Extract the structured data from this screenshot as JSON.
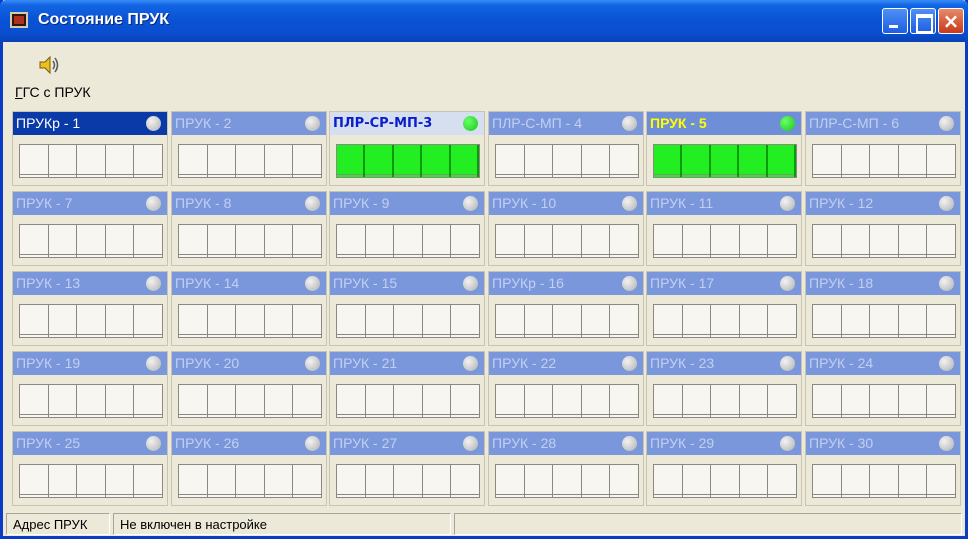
{
  "window": {
    "title": "Состояние ПРУК"
  },
  "toolbar": {
    "ggs_button": {
      "underlined": "Г",
      "rest": "ГС с ПРУК",
      "icon": "speaker-icon"
    }
  },
  "panels": [
    {
      "label": "ПРУКр - 1",
      "state": "selected",
      "indicator": "gray",
      "active": false
    },
    {
      "label": "ПРУК - 2",
      "state": "normal",
      "indicator": "gray",
      "active": false
    },
    {
      "label": "ПЛР-СР-МП-3",
      "state": "light",
      "indicator": "green",
      "active": true
    },
    {
      "label": "ПЛР-С-МП - 4",
      "state": "normal",
      "indicator": "gray",
      "active": false
    },
    {
      "label": "ПРУК - 5",
      "state": "yellow",
      "indicator": "green",
      "active": true
    },
    {
      "label": "ПЛР-С-МП - 6",
      "state": "normal",
      "indicator": "gray",
      "active": false
    },
    {
      "label": "ПРУК - 7",
      "state": "normal",
      "indicator": "gray",
      "active": false
    },
    {
      "label": "ПРУК - 8",
      "state": "normal",
      "indicator": "gray",
      "active": false
    },
    {
      "label": "ПРУК - 9",
      "state": "normal",
      "indicator": "gray",
      "active": false
    },
    {
      "label": "ПРУК - 10",
      "state": "normal",
      "indicator": "gray",
      "active": false
    },
    {
      "label": "ПРУК - 11",
      "state": "normal",
      "indicator": "gray",
      "active": false
    },
    {
      "label": "ПРУК - 12",
      "state": "normal",
      "indicator": "gray",
      "active": false
    },
    {
      "label": "ПРУК - 13",
      "state": "normal",
      "indicator": "gray",
      "active": false
    },
    {
      "label": "ПРУК - 14",
      "state": "normal",
      "indicator": "gray",
      "active": false
    },
    {
      "label": "ПРУК - 15",
      "state": "normal",
      "indicator": "gray",
      "active": false
    },
    {
      "label": "ПРУКр - 16",
      "state": "normal",
      "indicator": "gray",
      "active": false
    },
    {
      "label": "ПРУК - 17",
      "state": "normal",
      "indicator": "gray",
      "active": false
    },
    {
      "label": "ПРУК - 18",
      "state": "normal",
      "indicator": "gray",
      "active": false
    },
    {
      "label": "ПРУК - 19",
      "state": "normal",
      "indicator": "gray",
      "active": false
    },
    {
      "label": "ПРУК - 20",
      "state": "normal",
      "indicator": "gray",
      "active": false
    },
    {
      "label": "ПРУК - 21",
      "state": "normal",
      "indicator": "gray",
      "active": false
    },
    {
      "label": "ПРУК - 22",
      "state": "normal",
      "indicator": "gray",
      "active": false
    },
    {
      "label": "ПРУК - 23",
      "state": "normal",
      "indicator": "gray",
      "active": false
    },
    {
      "label": "ПРУК - 24",
      "state": "normal",
      "indicator": "gray",
      "active": false
    },
    {
      "label": "ПРУК - 25",
      "state": "normal",
      "indicator": "gray",
      "active": false
    },
    {
      "label": "ПРУК - 26",
      "state": "normal",
      "indicator": "gray",
      "active": false
    },
    {
      "label": "ПРУК - 27",
      "state": "normal",
      "indicator": "gray",
      "active": false
    },
    {
      "label": "ПРУК - 28",
      "state": "normal",
      "indicator": "gray",
      "active": false
    },
    {
      "label": "ПРУК - 29",
      "state": "normal",
      "indicator": "gray",
      "active": false
    },
    {
      "label": "ПРУК - 30",
      "state": "normal",
      "indicator": "gray",
      "active": false
    }
  ],
  "status": {
    "field1": "Адрес ПРУК",
    "field2": "Не включен в настройке",
    "field3": ""
  },
  "colors": {
    "header_normal": "#7b97dc",
    "header_selected": "#0a3aa8",
    "header_light": "#d6dff0",
    "indicator_green": "#22ee22",
    "indicator_gray": "#c8c8c8",
    "label_yellow": "#ffff00"
  }
}
